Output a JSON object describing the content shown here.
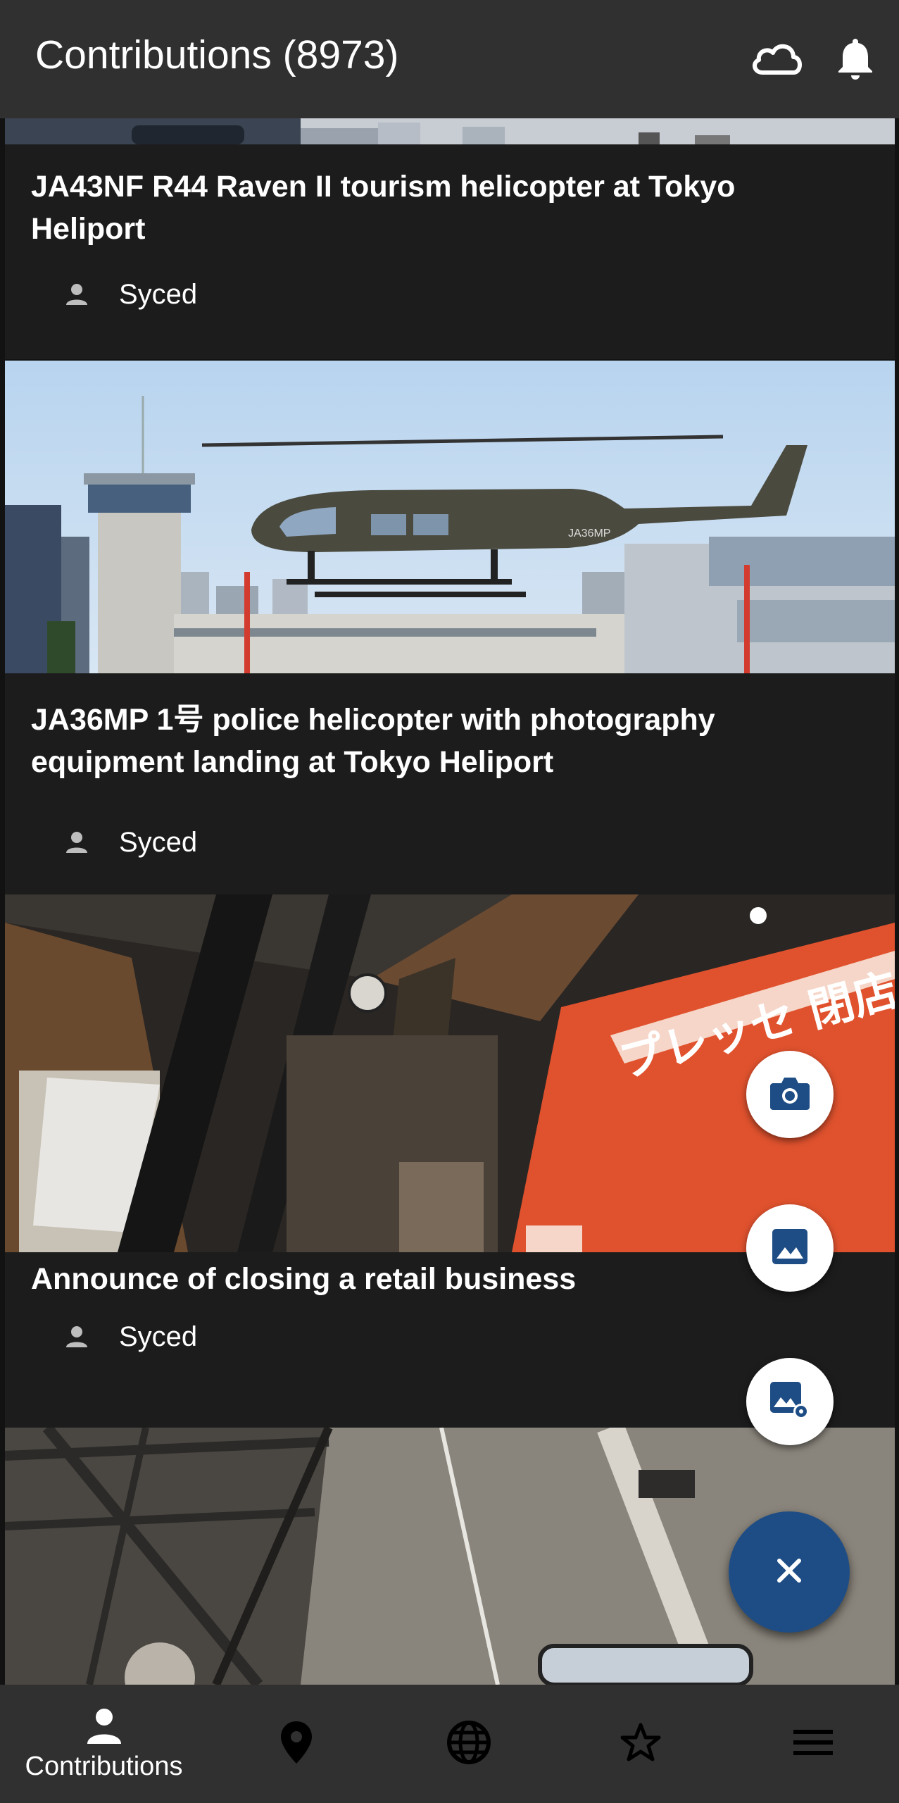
{
  "appbar": {
    "title": "Contributions (8973)",
    "icons": [
      "cloud-icon",
      "bell-icon"
    ]
  },
  "feed": {
    "cards": [
      {
        "title": "JA43NF R44 Raven II tourism helicopter at Tokyo Heliport",
        "author": "Syced",
        "image": "helicopter-r44-photo"
      },
      {
        "title": "JA36MP 1号 police helicopter with photography equipment landing at Tokyo Heliport",
        "author": "Syced",
        "image": "police-helicopter-photo",
        "image_text": "JA36MP"
      },
      {
        "title": "Announce of closing a retail business",
        "author": "Syced",
        "image": "store-closing-photo",
        "image_text": "プレッセ 閉店"
      },
      {
        "title": "",
        "author": "",
        "image": "steel-structure-photo"
      }
    ]
  },
  "fab": {
    "camera": "camera-icon",
    "gallery": "image-icon",
    "custom_picker": "image-picker-icon",
    "close": "close-icon",
    "accent": "#1e4d85"
  },
  "bottom_nav": {
    "items": [
      {
        "label": "Contributions",
        "icon": "person-icon",
        "active": true
      },
      {
        "label": "",
        "icon": "map-pin-icon"
      },
      {
        "label": "",
        "icon": "globe-icon"
      },
      {
        "label": "",
        "icon": "star-icon"
      },
      {
        "label": "",
        "icon": "menu-icon"
      }
    ]
  }
}
